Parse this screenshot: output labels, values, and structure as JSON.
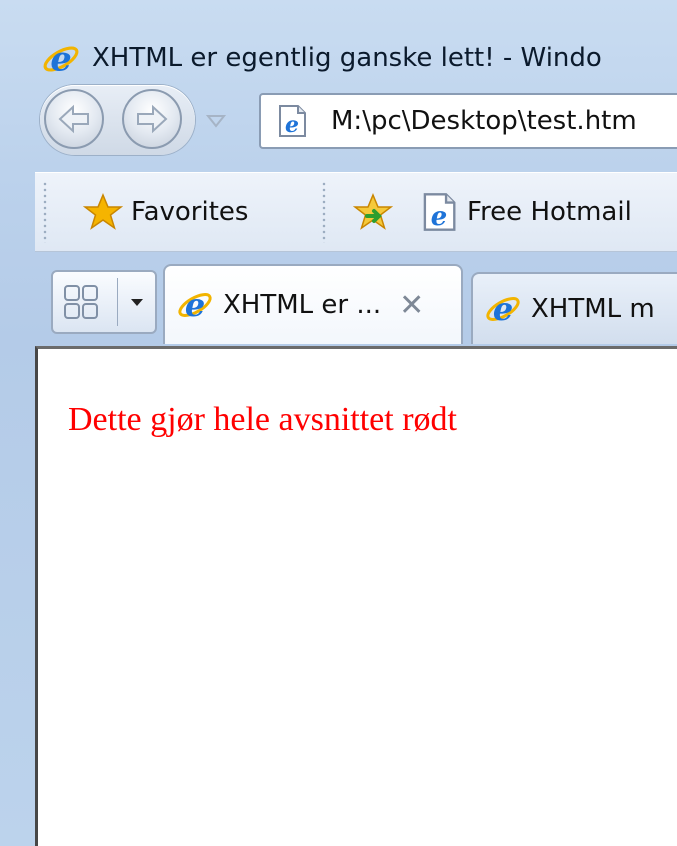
{
  "window": {
    "title": "XHTML er egentlig ganske lett! - Windo"
  },
  "navigation": {
    "back_button": "back",
    "forward_button": "forward",
    "recent_pages_dropdown": "recent-pages",
    "address": "M:\\pc\\Desktop\\test.htm"
  },
  "favorites_bar": {
    "favorites_label": "Favorites",
    "items": [
      {
        "label": "Free Hotmail"
      }
    ]
  },
  "tabs": [
    {
      "label": "XHTML er ...",
      "active": true,
      "close": "✕"
    },
    {
      "label": "XHTML m",
      "active": false
    }
  ],
  "page": {
    "paragraph": "Dette gjør hele avsnittet rødt",
    "paragraph_color": "#ff0000"
  },
  "icons": {
    "ie": "internet-explorer-icon",
    "page": "page-icon",
    "star": "favorites-star-icon",
    "add_favorite": "add-to-favorites-icon",
    "quick_tabs": "quick-tabs-icon"
  },
  "colors": {
    "chrome": "#bcd2ec",
    "ie_blue": "#1e73d8",
    "star_gold": "#f5b400"
  }
}
